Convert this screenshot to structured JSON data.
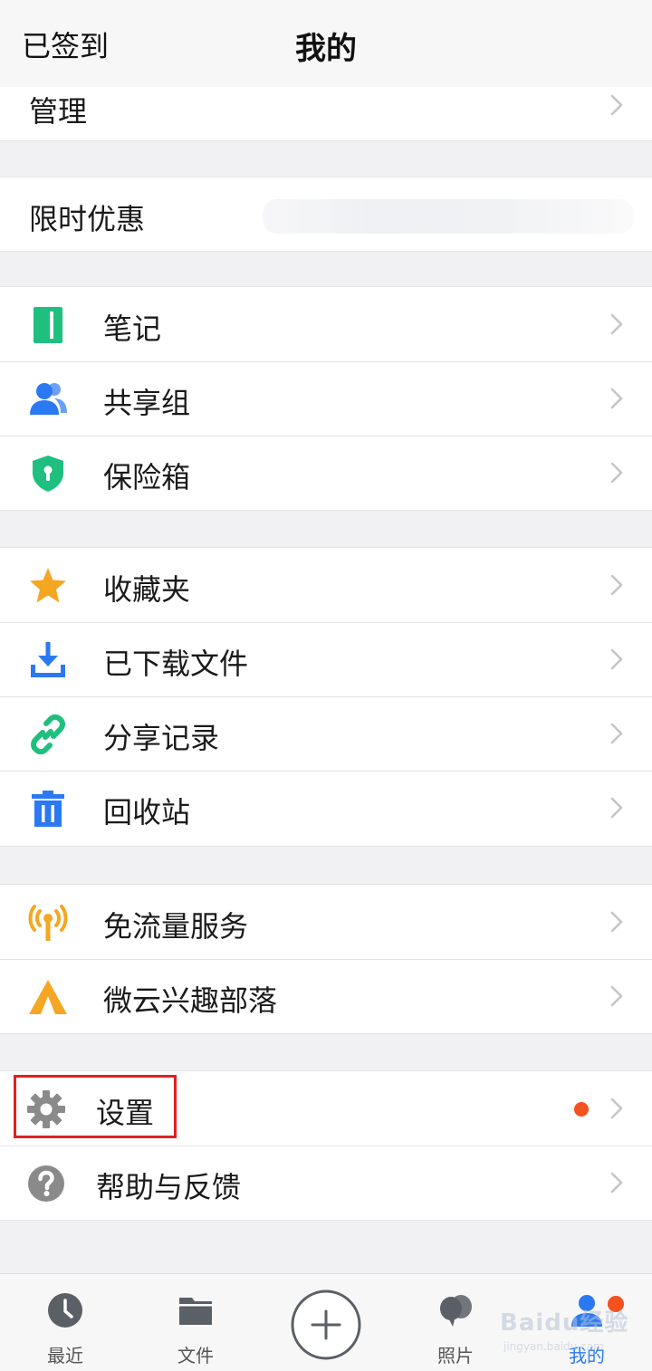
{
  "nav": {
    "left_label": "已签到",
    "title": "我的"
  },
  "sections": {
    "manage": {
      "label": "管理"
    },
    "promo": {
      "label": "限时优惠"
    },
    "group1": [
      {
        "label": "笔记",
        "icon": "note-icon",
        "color": "#1fbf7f"
      },
      {
        "label": "共享组",
        "icon": "group-icon",
        "color": "#2b79f2"
      },
      {
        "label": "保险箱",
        "icon": "shield-lock-icon",
        "color": "#1fbf7f"
      }
    ],
    "group2": [
      {
        "label": "收藏夹",
        "icon": "star-icon",
        "color": "#f5a623"
      },
      {
        "label": "已下载文件",
        "icon": "download-icon",
        "color": "#2b79f2"
      },
      {
        "label": "分享记录",
        "icon": "link-icon",
        "color": "#1fbf7f"
      },
      {
        "label": "回收站",
        "icon": "trash-icon",
        "color": "#2b79f2"
      }
    ],
    "group3": [
      {
        "label": "免流量服务",
        "icon": "signal-tower-icon",
        "color": "#f5a623"
      },
      {
        "label": "微云兴趣部落",
        "icon": "tent-icon",
        "color": "#f5a623"
      }
    ],
    "group4": [
      {
        "label": "设置",
        "icon": "gear-icon",
        "color": "#8a8a8a",
        "has_dot": true,
        "highlighted": true
      },
      {
        "label": "帮助与反馈",
        "icon": "help-icon",
        "color": "#8a8a8a"
      }
    ]
  },
  "tab_bar": {
    "tabs": [
      {
        "label": "最近",
        "icon": "clock-icon",
        "active": false
      },
      {
        "label": "文件",
        "icon": "folder-icon",
        "active": false
      },
      {
        "label": "",
        "icon": "add-icon",
        "active": false
      },
      {
        "label": "照片",
        "icon": "photos-icon",
        "active": false
      },
      {
        "label": "我的",
        "icon": "profile-icon",
        "active": true,
        "badge": true
      }
    ]
  },
  "watermark": {
    "text": "Baidu经验",
    "sub": "jingyan.baidu.com"
  },
  "colors": {
    "accent": "#2b79f2",
    "badge": "#f4511e",
    "highlight_box": "#e02020"
  }
}
